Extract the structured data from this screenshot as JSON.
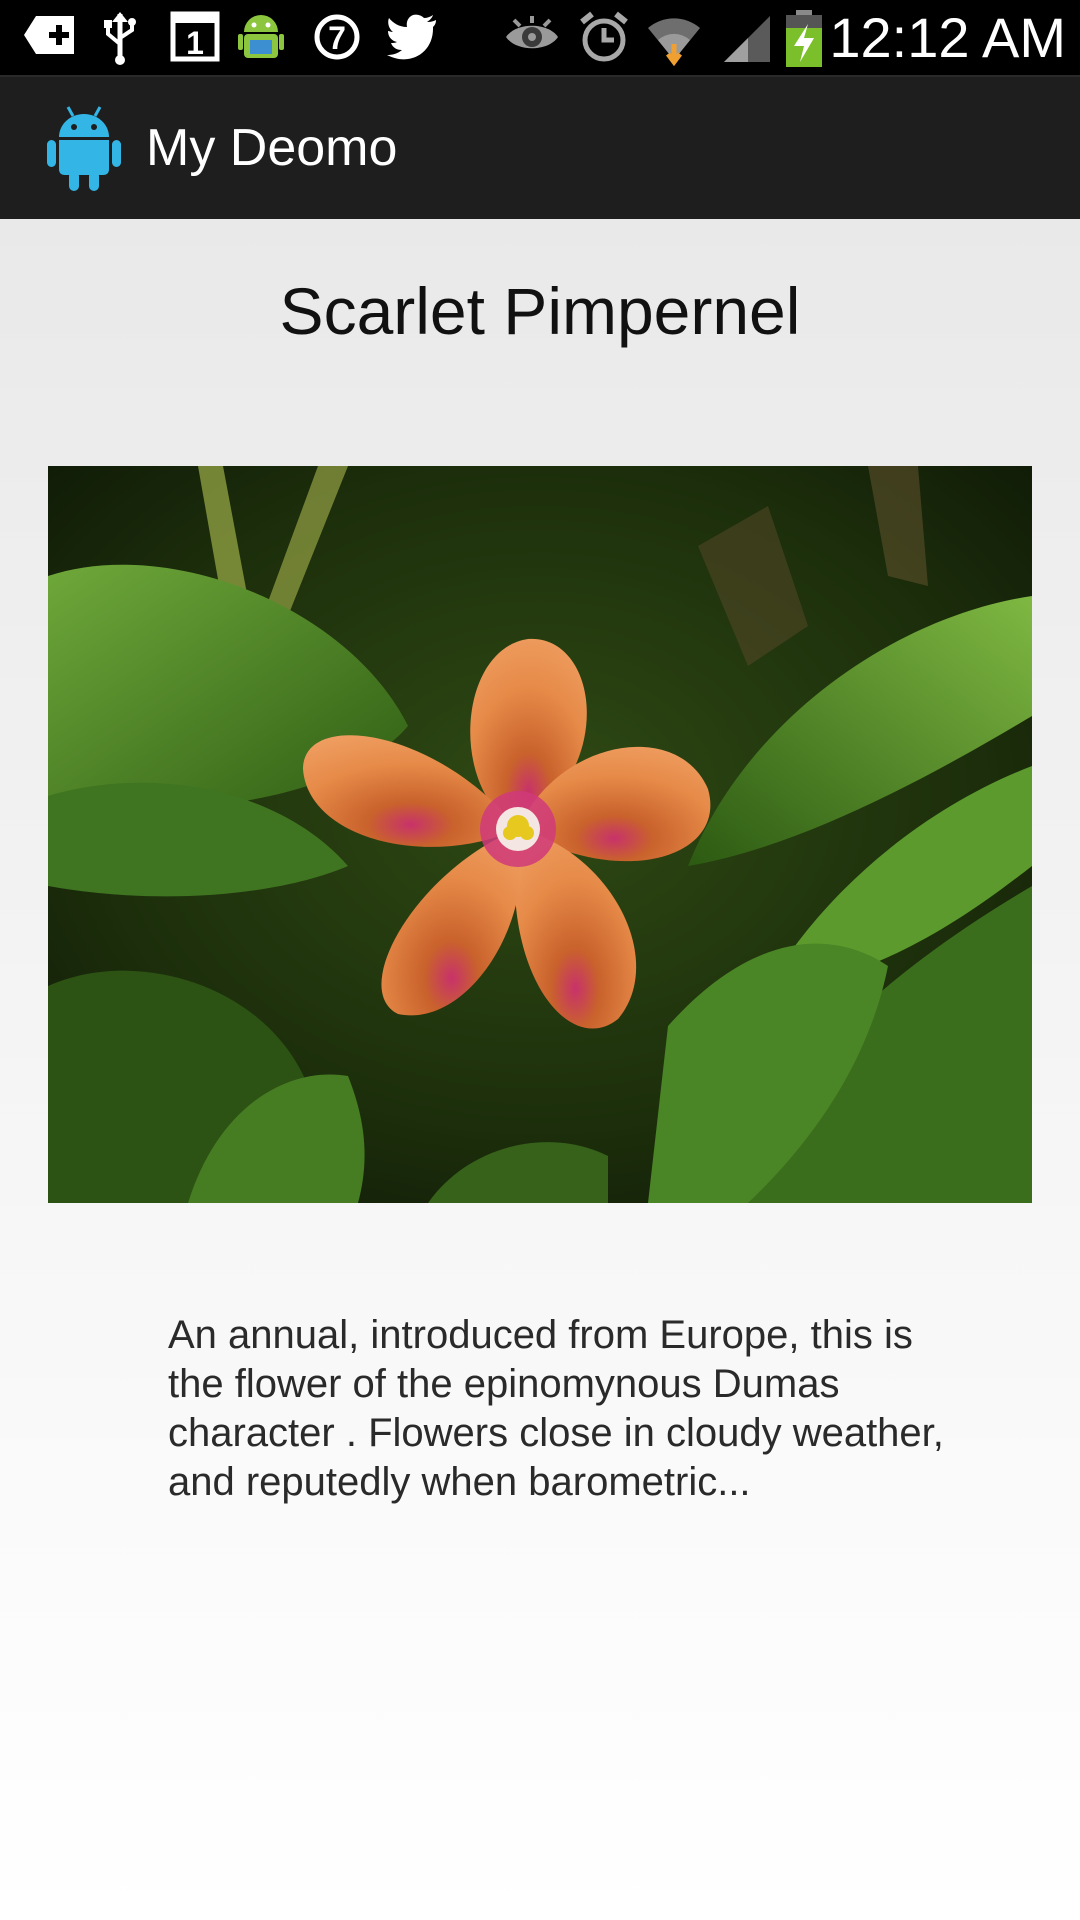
{
  "status_bar": {
    "left_icons": [
      "add-notification-icon",
      "usb-icon",
      "calendar-icon",
      "android-debug-icon",
      "seven-icon",
      "twitter-icon"
    ],
    "right_icons": [
      "eye-icon",
      "alarm-icon",
      "wifi-icon",
      "signal-icon",
      "battery-charging-icon"
    ],
    "calendar_day": "1",
    "seven_label": "7",
    "time": "12:12 AM"
  },
  "action_bar": {
    "app_icon": "android-icon",
    "title": "My Deomo",
    "accent_color": "#33b5e5"
  },
  "content": {
    "title": "Scarlet Pimpernel",
    "image_subject": "orange five-petal scarlet pimpernel flower with magenta center among green leaves",
    "description": "An annual, introduced from Europe, this is the flower of the epinomynous Dumas character . Flowers close in cloudy weather, and reputedly when barometric..."
  }
}
